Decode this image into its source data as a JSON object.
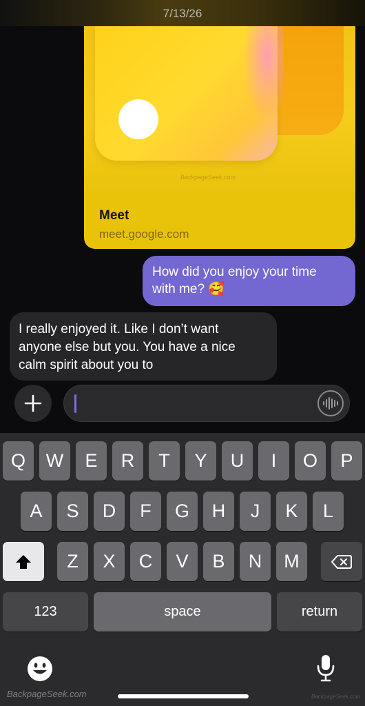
{
  "status": {
    "date": "7/13/26"
  },
  "link_preview": {
    "title": "Meet",
    "url": "meet.google.com",
    "image_watermark": "BackpageSeek.com"
  },
  "messages": [
    {
      "direction": "sent",
      "lines": [
        "How did you enjoy your time",
        "with me? 🥰"
      ]
    },
    {
      "direction": "received",
      "lines": [
        "I really enjoyed it. Like I don’t want",
        "anyone else but you. You have a nice",
        "calm spirit about you to"
      ]
    }
  ],
  "composer": {
    "plus_icon": "plus-icon",
    "value": "",
    "voice_icon": "waveform-icon"
  },
  "keyboard": {
    "row1": [
      "Q",
      "W",
      "E",
      "R",
      "T",
      "Y",
      "U",
      "I",
      "O",
      "P"
    ],
    "row2": [
      "A",
      "S",
      "D",
      "F",
      "G",
      "H",
      "J",
      "K",
      "L"
    ],
    "row3": [
      "Z",
      "X",
      "C",
      "V",
      "B",
      "N",
      "M"
    ],
    "shift_icon": "shift-icon",
    "delete_icon": "delete-icon",
    "numbers_label": "123",
    "space_label": "space",
    "return_label": "return",
    "emoji_icon": "emoji-icon",
    "mic_icon": "microphone-icon"
  },
  "watermarks": {
    "bottom_left": "BackpageSeek.com",
    "bottom_right": "BackpageSeek.com"
  },
  "colors": {
    "sent_bubble": "#7367d2",
    "received_bubble": "#262628",
    "link_card": "#e9c30a"
  }
}
